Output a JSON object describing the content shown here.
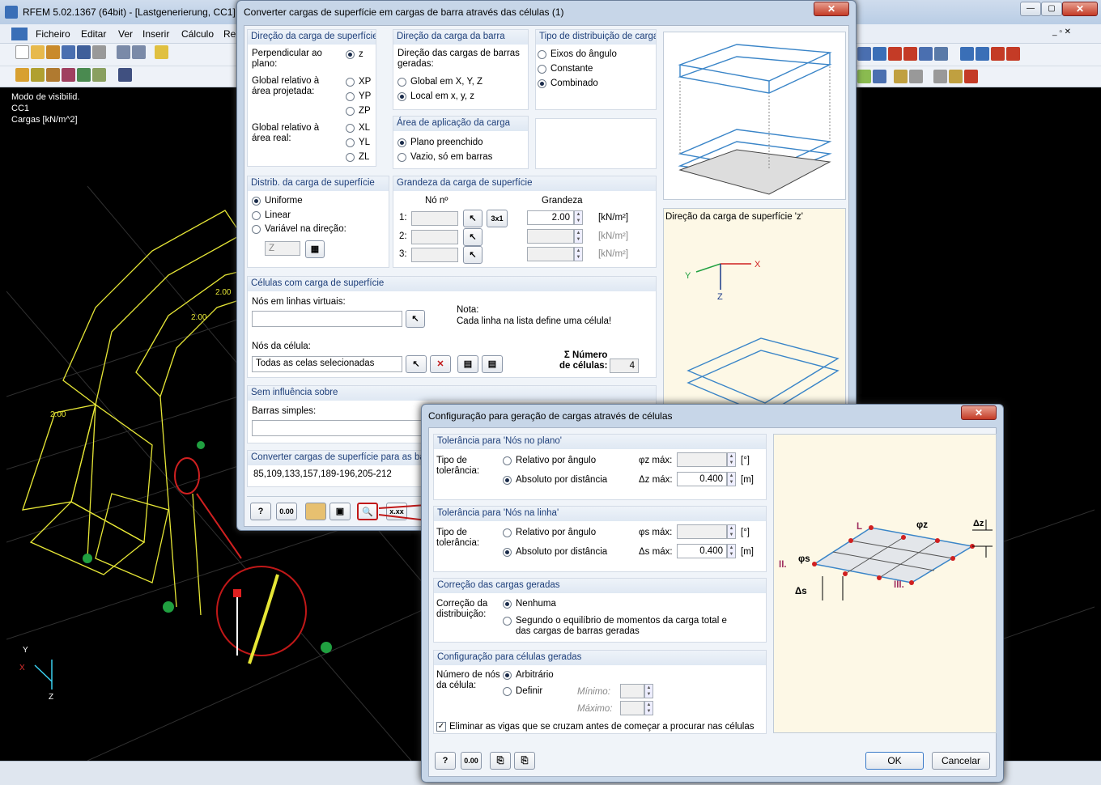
{
  "app": {
    "title": "RFEM 5.02.1367 (64bit) - [Lastgenerierung, CC1]"
  },
  "menu": [
    "Ficheiro",
    "Editar",
    "Ver",
    "Inserir",
    "Cálculo",
    "Re"
  ],
  "viewport": {
    "lines": [
      "Modo de visibilid.",
      "CC1",
      "Cargas [kN/m^2]"
    ],
    "labels": [
      "2.00",
      "2.00",
      "2.00"
    ],
    "axis": {
      "x": "X",
      "y": "Y",
      "z": "Z"
    }
  },
  "dlg1": {
    "title": "Converter cargas de superfície em cargas de barra através das células   (1)",
    "dir_sup": {
      "header": "Direção da carga de superfície",
      "perp": "Perpendicular ao\nplano:",
      "z": "z",
      "glob_proj": "Global relativo à\nárea projetada:",
      "xp": "XP",
      "yp": "YP",
      "zp": "ZP",
      "glob_real": "Global relativo à\nárea real:",
      "xl": "XL",
      "yl": "YL",
      "zl": "ZL"
    },
    "dir_barra": {
      "header": "Direção da carga da barra",
      "text": "Direção das cargas de barras\ngeradas:",
      "global": "Global em X, Y, Z",
      "local": "Local em x, y, z"
    },
    "tipo_dist": {
      "header": "Tipo de distribuição de carga",
      "eixos": "Eixos do ângulo",
      "constante": "Constante",
      "combinado": "Combinado"
    },
    "area_app": {
      "header": "Área de aplicação da carga",
      "plano": "Plano preenchido",
      "vazio": "Vazio, só em barras"
    },
    "distrib": {
      "header": "Distrib. da carga de superfície",
      "uniforme": "Uniforme",
      "linear": "Linear",
      "variavel": "Variável na direção:",
      "dir_value": "Z"
    },
    "grandeza": {
      "header": "Grandeza da carga de superfície",
      "no": "Nó nº",
      "grandeza": "Grandeza",
      "rows": [
        "1:",
        "2:",
        "3:"
      ],
      "value1": "2.00",
      "unit": "[kN/m²]",
      "btn": "3x1"
    },
    "celulas": {
      "header": "Células com carga de superfície",
      "nos_virt": "Nós em linhas virtuais:",
      "nota": "Nota:",
      "nota_text": "Cada linha na lista define uma célula!",
      "nos_cel": "Nós da célula:",
      "select": "Todas as celas selecionadas",
      "num_label": "Σ Número\nde células:",
      "num": "4"
    },
    "sem_infl": {
      "header": "Sem influência sobre",
      "barras": "Barras simples:"
    },
    "converter": {
      "header": "Converter cargas de superfície para as bar",
      "value": "85,109,133,157,189-196,205-212"
    },
    "preview_caption": "Direção da carga de superfície 'z'",
    "btn_labels": [
      "?",
      "0.00"
    ]
  },
  "dlg2": {
    "title": "Configuração para geração de cargas através de células",
    "tol_plano": {
      "header": "Tolerância para 'Nós no plano'",
      "tipo": "Tipo de\ntolerância:",
      "rel": "Relativo por ângulo",
      "abs": "Absoluto por distância",
      "phi": "φz máx:",
      "delta": "Δz máx:",
      "unit_deg": "[°]",
      "unit_m": "[m]",
      "value": "0.400"
    },
    "tol_linha": {
      "header": "Tolerância para 'Nós na linha'",
      "tipo": "Tipo de\ntolerância:",
      "rel": "Relativo por ângulo",
      "abs": "Absoluto por distância",
      "phi": "φs máx:",
      "delta": "Δs máx:",
      "unit_deg": "[°]",
      "unit_m": "[m]",
      "value": "0.400"
    },
    "correcao": {
      "header": "Correção das cargas geradas",
      "label": "Correção da\ndistribuição:",
      "nenhuma": "Nenhuma",
      "segundo": "Segundo o equilíbrio de momentos da carga total e\ndas cargas de barras geradas"
    },
    "config": {
      "header": "Configuração para células geradas",
      "label": "Número de nós\nda célula:",
      "arbitrario": "Arbitrário",
      "definir": "Definir",
      "minimo": "Mínimo:",
      "maximo": "Máximo:",
      "eliminar": "Eliminar as vigas que se cruzam antes de começar a procurar nas células"
    },
    "ok": "OK",
    "cancel": "Cancelar",
    "diagram": {
      "L": "L",
      "II": "II.",
      "III": "III.",
      "phiz": "φz",
      "phis": "φs",
      "dz": "Δz",
      "ds": "Δs"
    }
  }
}
